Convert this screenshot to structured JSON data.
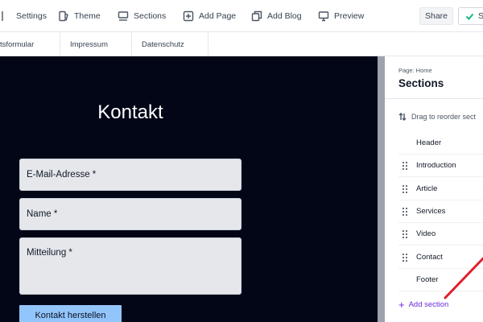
{
  "toolbar": {
    "settings_label": "Settings",
    "theme_label": "Theme",
    "sections_label": "Sections",
    "add_page_label": "Add Page",
    "add_blog_label": "Add Blog",
    "preview_label": "Preview",
    "share_label": "Share",
    "save_label": "S"
  },
  "page_tabs": [
    "tsformular",
    "Impressum",
    "Datenschutz"
  ],
  "preview": {
    "title": "Kontakt",
    "email_label": "E-Mail-Adresse *",
    "name_label": "Name *",
    "message_label": "Mitteilung *",
    "submit_label": "Kontakt herstellen",
    "background": "#020617",
    "button_color": "#93c5fd"
  },
  "sections_panel": {
    "kicker": "Page: Home",
    "title": "Sections",
    "drag_hint": "Drag to reorder sect",
    "items": [
      "Header",
      "Introduction",
      "Article",
      "Services",
      "Video",
      "Contact",
      "Footer"
    ],
    "add_label": "Add section",
    "accent_color": "#6d28d9"
  },
  "annotation_color": "#e11d2a"
}
